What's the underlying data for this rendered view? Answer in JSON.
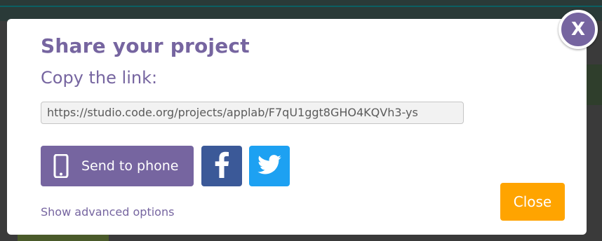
{
  "dialog": {
    "title": "Share your project",
    "subtitle": "Copy the link:",
    "link_value": "https://studio.code.org/projects/applab/F7qU1ggt8GHO4KQVh3-ys",
    "send_to_phone_label": "Send to phone",
    "facebook_icon": "facebook-icon",
    "twitter_icon": "twitter-icon",
    "phone_icon": "phone-icon",
    "advanced_options_label": "Show advanced options",
    "close_label": "Close",
    "x_label": "X"
  },
  "colors": {
    "brand_purple": "#7665a0",
    "facebook_blue": "#3b5998",
    "twitter_blue": "#1da1f2",
    "close_orange": "#ffa400"
  }
}
